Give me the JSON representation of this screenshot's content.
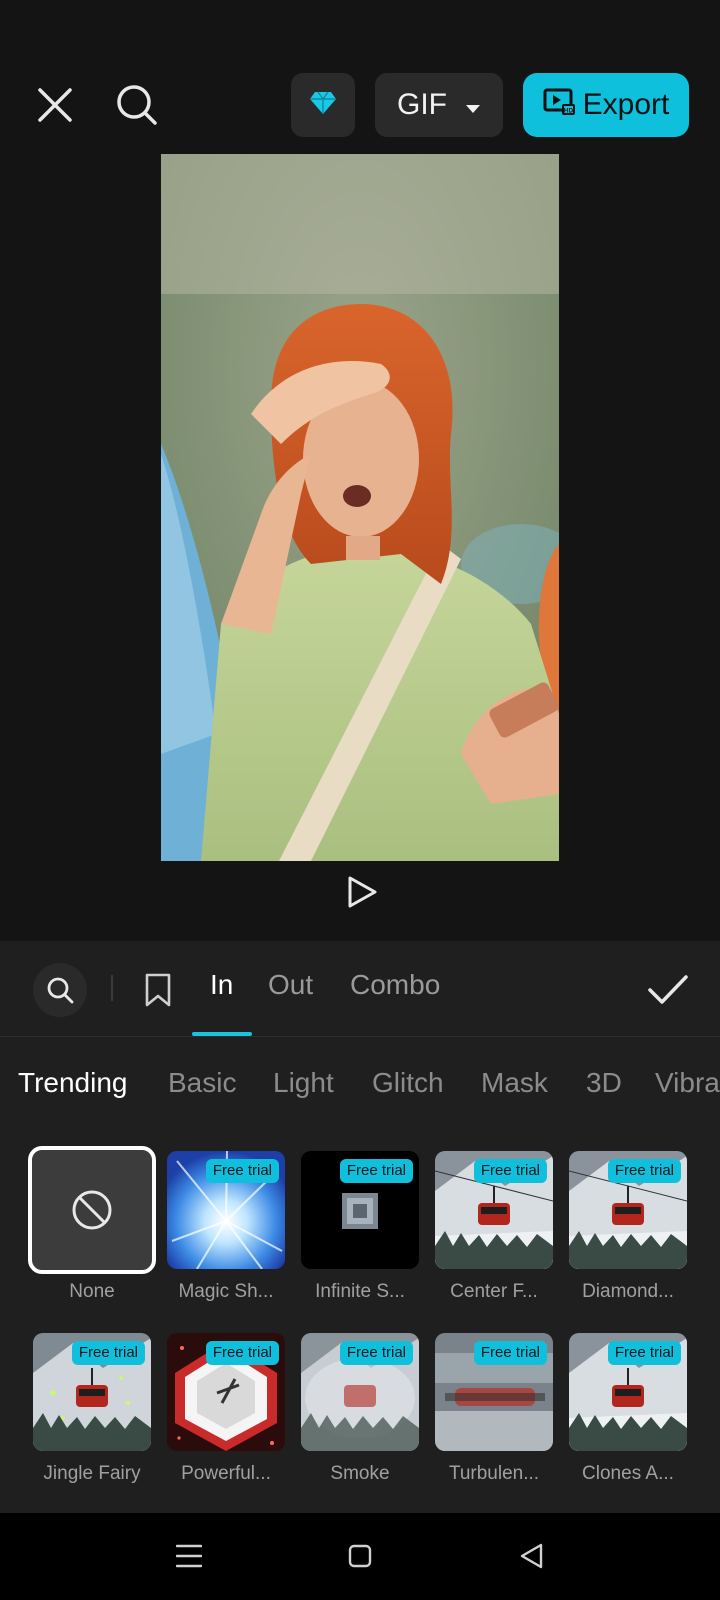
{
  "toolbar": {
    "close_icon": "close-icon",
    "search_icon": "search-icon",
    "pro_icon": "diamond-icon",
    "format_label": "GIF",
    "export_label": "Export",
    "accent_color": "#0fc0dd"
  },
  "player": {
    "play_icon": "play-icon"
  },
  "panel": {
    "tabs": [
      {
        "label": "In",
        "active": true
      },
      {
        "label": "Out",
        "active": false
      },
      {
        "label": "Combo",
        "active": false
      }
    ],
    "categories": [
      {
        "label": "Trending",
        "active": true
      },
      {
        "label": "Basic",
        "active": false
      },
      {
        "label": "Light",
        "active": false
      },
      {
        "label": "Glitch",
        "active": false
      },
      {
        "label": "Mask",
        "active": false
      },
      {
        "label": "3D",
        "active": false
      },
      {
        "label": "Vibra",
        "active": false
      }
    ],
    "effects": [
      {
        "label": "None",
        "badge": "",
        "selected": true
      },
      {
        "label": "Magic Sh...",
        "badge": "Free trial"
      },
      {
        "label": "Infinite S...",
        "badge": "Free trial"
      },
      {
        "label": "Center F...",
        "badge": "Free trial"
      },
      {
        "label": "Diamond...",
        "badge": "Free trial"
      },
      {
        "label": "Jingle Fairy",
        "badge": "Free trial"
      },
      {
        "label": "Powerful...",
        "badge": "Free trial"
      },
      {
        "label": "Smoke",
        "badge": "Free trial"
      },
      {
        "label": "Turbulen...",
        "badge": "Free trial"
      },
      {
        "label": "Clones A...",
        "badge": "Free trial"
      }
    ]
  },
  "navbar": {
    "menu_icon": "menu-icon",
    "home_icon": "home-icon",
    "back_icon": "back-icon"
  }
}
